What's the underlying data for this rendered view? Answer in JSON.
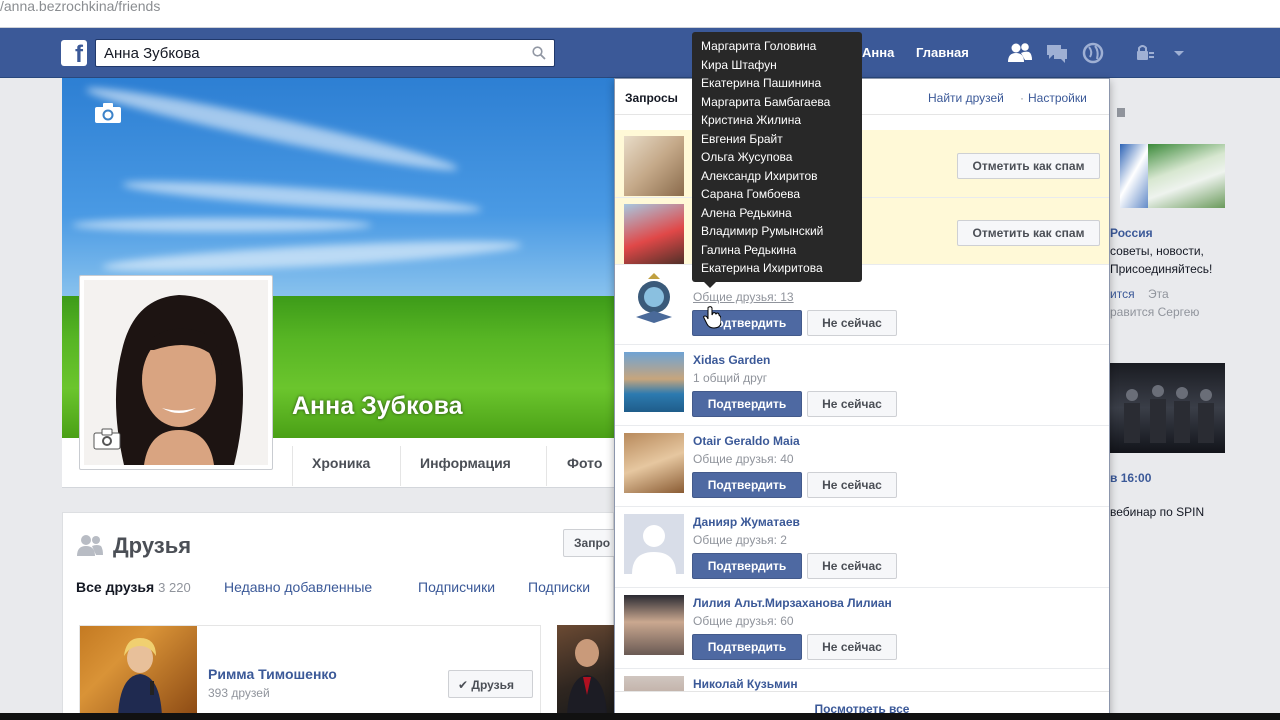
{
  "browser": {
    "url": "/anna.bezrochkina/friends"
  },
  "header": {
    "logo": "f",
    "search_value": "Анна Зубкова",
    "profile_link": "Анна",
    "home_link": "Главная"
  },
  "profile": {
    "name": "Анна Зубкова",
    "tabs": [
      "Хроника",
      "Информация",
      "Фото"
    ]
  },
  "friends_section": {
    "title": "Друзья",
    "requests_button": "Запро",
    "tabs": [
      {
        "label": "Все друзья",
        "count": "3 220"
      },
      {
        "label": "Недавно добавленные"
      },
      {
        "label": "Подписчики"
      },
      {
        "label": "Подписки"
      }
    ],
    "card": {
      "name": "Римма Тимошенко",
      "sub": "393 друзей",
      "button": "✔ Друзья"
    }
  },
  "panel": {
    "title": "Запросы",
    "find_friends": "Найти друзей",
    "settings": "Настройки",
    "spam_label": "Отметить как спам",
    "confirm_label": "Подтвердить",
    "later_label": "Не сейчас",
    "requests": [
      {
        "name": "",
        "mutual": "",
        "type": "spam"
      },
      {
        "name": "",
        "mutual": "",
        "type": "spam"
      },
      {
        "name": "",
        "mutual": "Общие друзья: 13",
        "type": "request"
      },
      {
        "name": "Xidas Garden",
        "mutual": "1 общий друг",
        "type": "request"
      },
      {
        "name": "Otair Geraldo Maia",
        "mutual": "Общие друзья: 40",
        "type": "request"
      },
      {
        "name": "Данияр Жуматаев",
        "mutual": "Общие друзья: 2",
        "type": "request"
      },
      {
        "name": "Лилия Альт.Мирзаханова Лилиан",
        "mutual": "Общие друзья: 60",
        "type": "request"
      },
      {
        "name": "Николай Кузьмин",
        "mutual": "",
        "type": "request"
      }
    ],
    "footer": "Посмотреть все"
  },
  "tooltip": {
    "names": [
      "Маргарита Головина",
      "Кира Штафун",
      "Екатерина Пашинина",
      "Маргарита Бамбагаева",
      "Кристина Жилина",
      "Евгения Брайт",
      "Ольга Жусупова",
      "Александр Ихиритов",
      "Сарана Гомбоева",
      "Алена Редькина",
      "Владимир Румынский",
      "Галина Редькина",
      "Екатерина Ихиритова"
    ]
  },
  "right_column": {
    "ad_title": "Россия",
    "ad_line1": "советы, новости,",
    "ad_line2": "Присоединяйтесь!",
    "ad_like": "ится",
    "ad_like2": "Эта",
    "ad_line3": "равится Сергею",
    "event_time": "в 16:00",
    "event_line": "вебинар по SPIN"
  }
}
